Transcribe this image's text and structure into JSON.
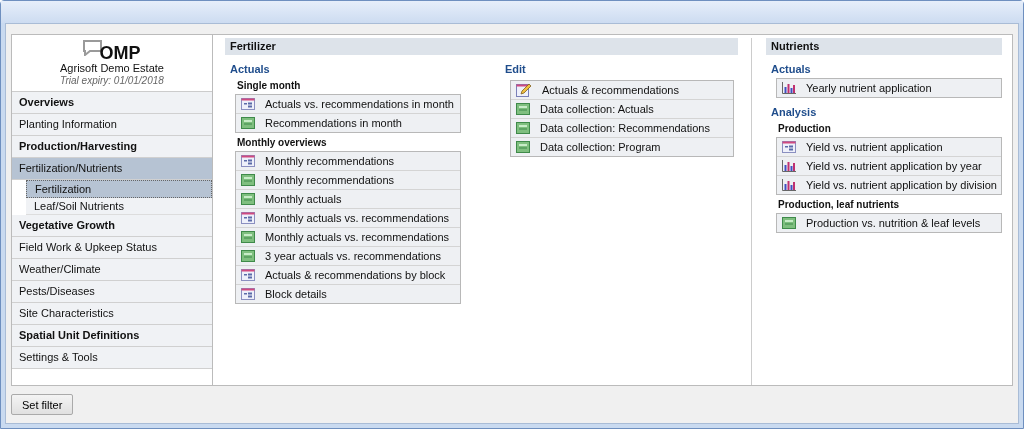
{
  "brand": {
    "logo": "OMP",
    "estate": "Agrisoft Demo Estate",
    "trial": "Trial expiry: 01/01/2018"
  },
  "sidebar": {
    "items": [
      {
        "label": "Overviews",
        "bold": true,
        "selected": false
      },
      {
        "label": "Planting Information",
        "bold": false,
        "selected": false
      },
      {
        "label": "Production/Harvesting",
        "bold": true,
        "selected": false
      },
      {
        "label": "Fertilization/Nutrients",
        "bold": false,
        "selected": false,
        "expanded": true,
        "children": [
          {
            "label": "Fertilization",
            "selected": true
          },
          {
            "label": "Leaf/Soil Nutrients",
            "selected": false
          }
        ]
      },
      {
        "label": "Vegetative Growth",
        "bold": true,
        "selected": false
      },
      {
        "label": "Field Work & Upkeep Status",
        "bold": false,
        "selected": false
      },
      {
        "label": "Weather/Climate",
        "bold": false,
        "selected": false
      },
      {
        "label": "Pests/Diseases",
        "bold": false,
        "selected": false
      },
      {
        "label": "Site Characteristics",
        "bold": false,
        "selected": false
      },
      {
        "label": "Spatial Unit Definitions",
        "bold": true,
        "selected": false
      },
      {
        "label": "Settings & Tools",
        "bold": false,
        "selected": false
      }
    ]
  },
  "sections": [
    {
      "title": "Fertilizer",
      "columns": [
        [
          {
            "heading": "Actuals",
            "groups": [
              {
                "subheading": "Single month",
                "links": [
                  {
                    "label": "Actuals vs. recommendations in month",
                    "kind": "report"
                  },
                  {
                    "label": "Recommendations in month",
                    "kind": "sheet"
                  }
                ]
              },
              {
                "subheading": "Monthly overviews",
                "links": [
                  {
                    "label": "Monthly recommendations",
                    "kind": "report"
                  },
                  {
                    "label": "Monthly recommendations",
                    "kind": "sheet"
                  },
                  {
                    "label": "Monthly actuals",
                    "kind": "sheet"
                  },
                  {
                    "label": "Monthly actuals vs. recommendations",
                    "kind": "report"
                  },
                  {
                    "label": "Monthly actuals vs. recommendations",
                    "kind": "sheet"
                  },
                  {
                    "label": "3 year actuals vs. recommendations",
                    "kind": "sheet"
                  },
                  {
                    "label": "Actuals & recommendations by block",
                    "kind": "report"
                  },
                  {
                    "label": "Block details",
                    "kind": "report"
                  }
                ]
              }
            ]
          }
        ],
        [
          {
            "heading": "Edit",
            "groups": [
              {
                "links": [
                  {
                    "label": "Actuals & recommendations",
                    "kind": "edit"
                  },
                  {
                    "label": "Data collection: Actuals",
                    "kind": "sheet"
                  },
                  {
                    "label": "Data collection: Recommendations",
                    "kind": "sheet"
                  },
                  {
                    "label": "Data collection: Program",
                    "kind": "sheet"
                  }
                ]
              }
            ]
          }
        ]
      ]
    },
    {
      "title": "Nutrients",
      "columns": [
        [
          {
            "heading": "Actuals",
            "groups": [
              {
                "links": [
                  {
                    "label": "Yearly nutrient application",
                    "kind": "chart"
                  }
                ]
              }
            ]
          },
          {
            "heading": "Analysis",
            "groups": [
              {
                "subheading": "Production",
                "links": [
                  {
                    "label": "Yield vs. nutrient application",
                    "kind": "report"
                  },
                  {
                    "label": "Yield vs. nutrient application by year",
                    "kind": "chart"
                  },
                  {
                    "label": "Yield vs. nutrient application by division",
                    "kind": "chart"
                  }
                ]
              },
              {
                "subheading": "Production, leaf nutrients",
                "links": [
                  {
                    "label": "Production vs. nutrition & leaf levels",
                    "kind": "sheet"
                  }
                ]
              }
            ]
          }
        ]
      ]
    }
  ],
  "footer": {
    "button": "Set filter"
  }
}
